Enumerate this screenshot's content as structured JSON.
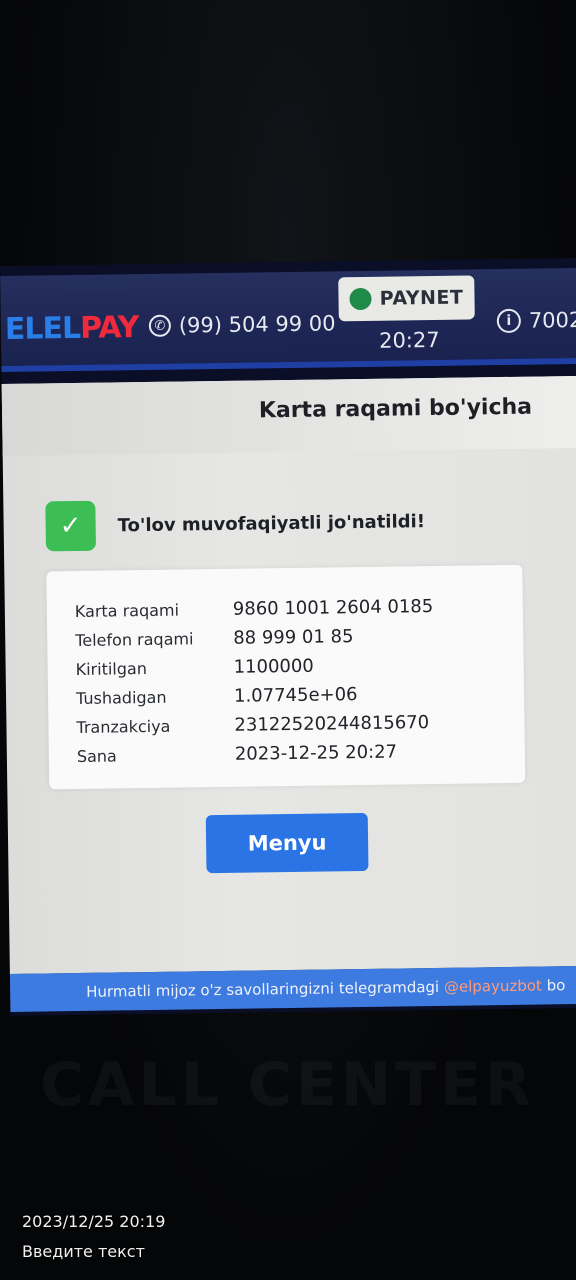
{
  "topbar": {
    "logo_part1": "ELEL",
    "logo_part2": "PAY",
    "phone": "(99) 504 99 00",
    "paynet": "PAYNET",
    "time": "20:27",
    "info_number": "7002"
  },
  "page": {
    "title": "Karta raqami bo'yicha",
    "success_message": "To'lov muvofaqiyatli jo'natildi!"
  },
  "receipt": {
    "rows": [
      {
        "label": "Karta raqami",
        "value": "9860 1001 2604 0185"
      },
      {
        "label": "Telefon raqami",
        "value": "88 999 01 85"
      },
      {
        "label": "Kiritilgan",
        "value": "1100000"
      },
      {
        "label": "Tushadigan",
        "value": "1.07745e+06"
      },
      {
        "label": "Tranzakciya",
        "value": "23122520244815670"
      },
      {
        "label": "Sana",
        "value": "2023-12-25 20:27"
      }
    ]
  },
  "menu_button": "Menyu",
  "ticker": {
    "text": "Hurmatli mijoz o'z savollaringizni telegramdagi ",
    "handle": "@elpayuzbot",
    "tail": " bo"
  },
  "reflection_text": "CALL CENTER",
  "photo_stamp": {
    "date": "2023/12/25 20:19",
    "hint": "Введите текст"
  },
  "colors": {
    "topbar": "#1d2654",
    "accent_blue": "#2b74e6",
    "success_green": "#3cbe55",
    "logo_red": "#ef2a3c"
  }
}
